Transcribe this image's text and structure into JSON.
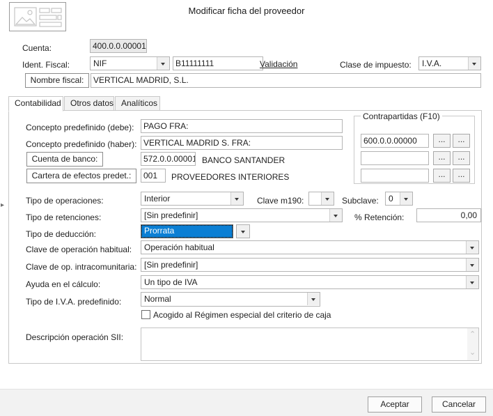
{
  "window": {
    "title": "Modificar ficha del proveedor",
    "record_icon": "record-placeholder-icon",
    "collapse_handle": "▸"
  },
  "header_form": {
    "cuenta_label": "Cuenta:",
    "cuenta_value": "400.0.0.00001",
    "ident_fiscal_label": "Ident. Fiscal:",
    "ident_fiscal_type": "NIF",
    "ident_fiscal_number": "B11111111",
    "validacion_link": "Validación",
    "clase_impuesto_label": "Clase de impuesto:",
    "clase_impuesto_value": "I.V.A.",
    "nombre_fiscal_label": "Nombre fiscal:",
    "nombre_fiscal_value": "VERTICAL MADRID, S.L."
  },
  "tabs": [
    {
      "label": "Contabilidad",
      "active": true
    },
    {
      "label": "Otros datos",
      "active": false
    },
    {
      "label": "Analíticos",
      "active": false
    }
  ],
  "contabilidad": {
    "concepto_debe_label": "Concepto predefinido (debe):",
    "concepto_debe_value": "PAGO FRA:",
    "concepto_haber_label": "Concepto predefinido (haber):",
    "concepto_haber_value": "VERTICAL MADRID S. FRA:",
    "cuenta_banco_label": "Cuenta de banco:",
    "cuenta_banco_code": "572.0.0.00001",
    "cuenta_banco_name": "BANCO SANTANDER",
    "cartera_label": "Cartera de efectos predet.:",
    "cartera_code": "001",
    "cartera_name": "PROVEEDORES INTERIORES",
    "tipo_operaciones_label": "Tipo de operaciones:",
    "tipo_operaciones_value": "Interior",
    "clave_m190_label": "Clave m190:",
    "clave_m190_value": "",
    "subclave_label": "Subclave:",
    "subclave_value": "0",
    "tipo_retenciones_label": "Tipo de retenciones:",
    "tipo_retenciones_value": "[Sin predefinir]",
    "pct_retencion_label": "% Retención:",
    "pct_retencion_value": "0,00",
    "tipo_deduccion_label": "Tipo de deducción:",
    "tipo_deduccion_value": "Prorrata",
    "clave_op_habitual_label": "Clave de operación habitual:",
    "clave_op_habitual_value": "Operación habitual",
    "clave_op_intra_label": "Clave de op. intracomunitaria:",
    "clave_op_intra_value": "[Sin predefinir]",
    "ayuda_calculo_label": "Ayuda en el cálculo:",
    "ayuda_calculo_value": "Un tipo de IVA",
    "tipo_iva_label": "Tipo de I.V.A. predefinido:",
    "tipo_iva_value": "Normal",
    "criterio_caja_label": "Acogido al Régimen especial del criterio de caja",
    "criterio_caja_checked": false,
    "descripcion_sii_label": "Descripción operación SII:",
    "descripcion_sii_value": "",
    "scroll_up_icon": "⌃",
    "scroll_down_icon": "⌄"
  },
  "contrapartidas": {
    "legend": "Contrapartidas (F10)",
    "rows": [
      {
        "value": "600.0.0.00000",
        "btn1": "...",
        "btn2": "..."
      },
      {
        "value": "",
        "btn1": "...",
        "btn2": "..."
      },
      {
        "value": "",
        "btn1": "...",
        "btn2": "..."
      }
    ]
  },
  "footer": {
    "accept_label": "Aceptar",
    "cancel_label": "Cancelar"
  },
  "colors": {
    "selection_blue": "#0b7fd4",
    "panel_border": "#c8c8c8",
    "footer_bg": "#f2f2f2",
    "disabled_field": "#e9e9e9"
  }
}
